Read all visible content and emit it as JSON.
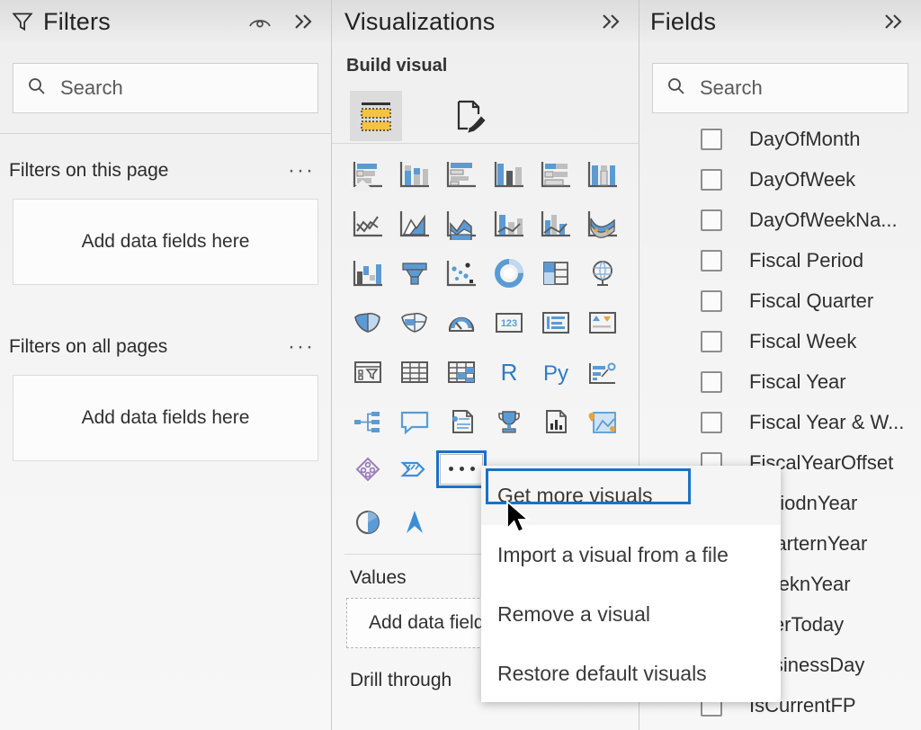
{
  "filters": {
    "title": "Filters",
    "icon": "funnel-icon",
    "eye_icon": "eye-icon",
    "collapse_icon": "double-chevron-right-icon",
    "search": {
      "placeholder": "Search",
      "value": "",
      "icon": "search-icon"
    },
    "sections": [
      {
        "label": "Filters on this page",
        "menu": "···",
        "dropzone": "Add data fields here"
      },
      {
        "label": "Filters on all pages",
        "menu": "···",
        "dropzone": "Add data fields here"
      }
    ]
  },
  "visualizations": {
    "title": "Visualizations",
    "collapse_icon": "double-chevron-right-icon",
    "build_label": "Build visual",
    "tabs": [
      {
        "name": "build-visual-tab",
        "icon": "build-fields-icon",
        "selected": true
      },
      {
        "name": "format-visual-tab",
        "icon": "paint-brush-page-icon",
        "selected": false
      }
    ],
    "visual_types": [
      "stacked-bar-chart-icon",
      "stacked-column-chart-icon",
      "clustered-bar-chart-icon",
      "clustered-column-chart-icon",
      "hundred-percent-stacked-bar-chart-icon",
      "hundred-percent-stacked-column-chart-icon",
      "line-chart-icon",
      "area-chart-icon",
      "stacked-area-chart-icon",
      "line-and-stacked-column-chart-icon",
      "line-and-clustered-column-chart-icon",
      "ribbon-chart-icon",
      "waterfall-chart-icon",
      "funnel-chart-icon",
      "scatter-chart-icon",
      "pie-chart-icon",
      "treemap-icon",
      "map-icon",
      "filled-map-icon",
      "shape-map-icon",
      "gauge-chart-icon",
      "card-icon",
      "multi-row-card-icon",
      "kpi-icon",
      "slicer-icon",
      "table-icon",
      "matrix-icon",
      "r-script-visual-icon",
      "python-visual-icon",
      "key-influencers-icon",
      "decomposition-tree-icon",
      "qna-icon",
      "smart-narrative-icon",
      "metrics-icon",
      "paginated-report-icon",
      "arcgis-maps-icon",
      "power-apps-icon",
      "power-automate-icon",
      "more-options-icon"
    ],
    "more_options_button": {
      "name": "more-visuals-button",
      "label": "···",
      "focused": true
    },
    "extra_visual_types": [
      "azure-map-pie-icon",
      "azure-map-navigator-icon"
    ],
    "wells": [
      {
        "label": "Values",
        "placeholder": "Add data fields here"
      },
      {
        "label": "Drill through",
        "placeholder": ""
      }
    ]
  },
  "context_menu": {
    "name": "visualizations-more-menu",
    "items": [
      {
        "label": "Get more visuals",
        "highlighted": true
      },
      {
        "label": "Import a visual from a file",
        "highlighted": false
      },
      {
        "label": "Remove a visual",
        "highlighted": false
      },
      {
        "label": "Restore default visuals",
        "highlighted": false
      }
    ]
  },
  "fields": {
    "title": "Fields",
    "collapse_icon": "double-chevron-right-icon",
    "search": {
      "placeholder": "Search",
      "value": "",
      "icon": "search-icon"
    },
    "items": [
      {
        "label": "DayOfMonth",
        "checked": false
      },
      {
        "label": "DayOfWeek",
        "checked": false
      },
      {
        "label": "DayOfWeekNa...",
        "checked": false
      },
      {
        "label": "Fiscal Period",
        "checked": false
      },
      {
        "label": "Fiscal Quarter",
        "checked": false
      },
      {
        "label": "Fiscal Week",
        "checked": false
      },
      {
        "label": "Fiscal Year",
        "checked": false
      },
      {
        "label": "Fiscal Year & W...",
        "checked": false
      },
      {
        "label": "FiscalYearOffset",
        "checked": false
      },
      {
        "label": "PeriodnYear",
        "checked": false
      },
      {
        "label": "QuarternYear",
        "checked": false
      },
      {
        "label": "WeeknYear",
        "checked": false
      },
      {
        "label": "AfterToday",
        "checked": false
      },
      {
        "label": "BusinessDay",
        "checked": false
      },
      {
        "label": "IsCurrentFP",
        "checked": false
      }
    ]
  },
  "colors": {
    "accent_blue": "#1a72c8",
    "icon_blue": "#5b9bd5",
    "icon_gray": "#595959",
    "panel_bg": "#f4f4f4",
    "header_gray": "#e2e2e2",
    "build_yellow": "#f5c242"
  }
}
